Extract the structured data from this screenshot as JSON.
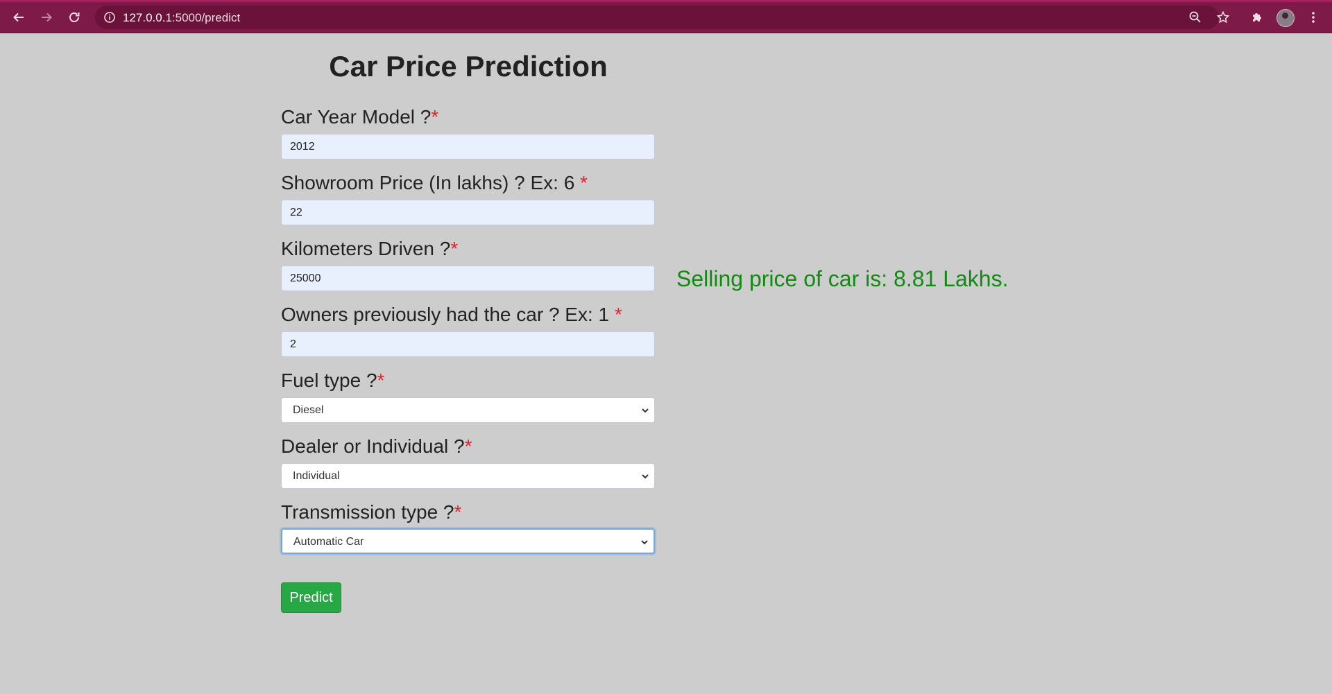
{
  "browser": {
    "url_host": "127.0.0.1",
    "url_rest": ":5000/predict",
    "theme_color": "#7d1a48"
  },
  "page": {
    "title": "Car Price Prediction",
    "required_mark": "*",
    "fields": {
      "year": {
        "label": "Car Year Model ?",
        "value": "2012"
      },
      "showroom_price": {
        "label": "Showroom Price (In lakhs) ? Ex: 6 ",
        "value": "22"
      },
      "kms_driven": {
        "label": "Kilometers Driven ?",
        "value": "25000"
      },
      "owners": {
        "label": "Owners previously had the car ? Ex: 1 ",
        "value": "2"
      },
      "fuel_type": {
        "label": "Fuel type ?",
        "selected": "Diesel"
      },
      "seller_type": {
        "label": "Dealer or Individual ?",
        "selected": "Individual"
      },
      "transmission": {
        "label": "Transmission type ?",
        "selected": "Automatic Car"
      }
    },
    "predict_label": "Predict",
    "result_text": "Selling price of car is: 8.81 Lakhs.",
    "colors": {
      "result": "#138a14",
      "button": "#27a844",
      "required": "#e0242f",
      "background": "#cdcdcd"
    }
  }
}
